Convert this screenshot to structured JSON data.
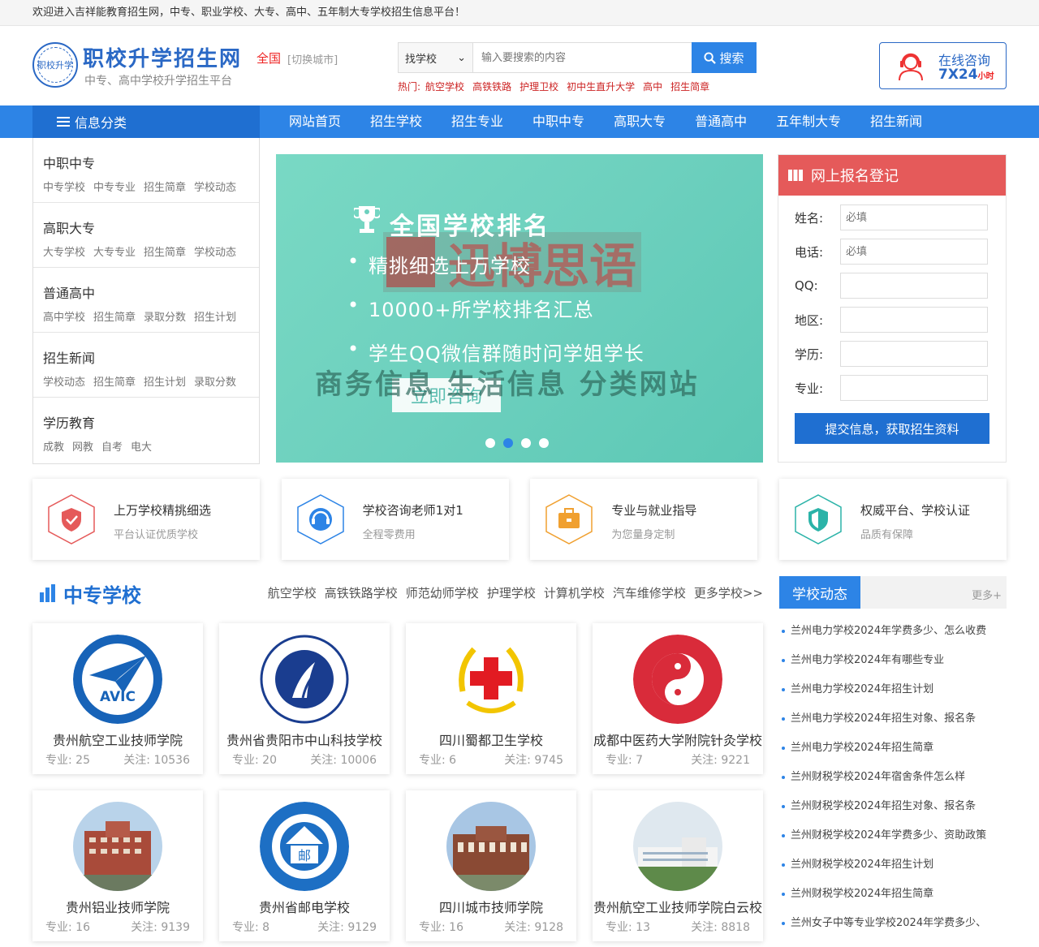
{
  "topbar": {
    "welcome": "欢迎进入吉祥能教育招生网，中专、职业学校、大专、高中、五年制大专学校招生信息平台！"
  },
  "header": {
    "logo_text": "职校升学",
    "title": "职校升学招生网",
    "subtitle": "中专、高中学校升学招生平台",
    "city": "全国",
    "city_switch": "[切换城市]",
    "search": {
      "select_value": "找学校",
      "placeholder": "输入要搜索的内容",
      "button": "搜索"
    },
    "hot_label": "热门:",
    "hot": [
      "航空学校",
      "高铁铁路",
      "护理卫校",
      "初中生直升大学",
      "高中",
      "招生简章"
    ],
    "consult": {
      "line1": "在线咨询",
      "line2": "7X24",
      "line2_small": "小时"
    }
  },
  "nav": {
    "category": "信息分类",
    "items": [
      "网站首页",
      "招生学校",
      "招生专业",
      "中职中专",
      "高职大专",
      "普通高中",
      "五年制大专",
      "招生新闻"
    ]
  },
  "sidebar": [
    {
      "title": "中职中专",
      "links": [
        "中专学校",
        "中专专业",
        "招生简章",
        "学校动态"
      ]
    },
    {
      "title": "高职大专",
      "links": [
        "大专学校",
        "大专专业",
        "招生简章",
        "学校动态"
      ]
    },
    {
      "title": "普通高中",
      "links": [
        "高中学校",
        "招生简章",
        "录取分数",
        "招生计划"
      ]
    },
    {
      "title": "招生新闻",
      "links": [
        "学校动态",
        "招生简章",
        "招生计划",
        "录取分数"
      ]
    },
    {
      "title": "学历教育",
      "links": [
        "成教",
        "网教",
        "自考",
        "电大"
      ]
    }
  ],
  "banner": {
    "title": "全国学校排名",
    "bullets": [
      "精挑细选上万学校",
      "10000+所学校排名汇总",
      "学生QQ微信群随时问学姐学长"
    ],
    "button": "立即咨询",
    "watermark": "迅博思语",
    "overlay": "商务信息 生活信息 分类网站",
    "active_slide": 2,
    "slide_count": 4
  },
  "register": {
    "title": "网上报名登记",
    "fields": [
      {
        "label": "姓名:",
        "placeholder": "必填"
      },
      {
        "label": "电话:",
        "placeholder": "必填"
      },
      {
        "label": "QQ:",
        "placeholder": ""
      },
      {
        "label": "地区:",
        "placeholder": ""
      },
      {
        "label": "学历:",
        "placeholder": ""
      },
      {
        "label": "专业:",
        "placeholder": ""
      }
    ],
    "submit": "提交信息，获取招生资料"
  },
  "features": [
    {
      "title": "上万学校精挑细选",
      "sub": "平台认证优质学校",
      "icon": "shield-check-icon",
      "color": "#e55a5a"
    },
    {
      "title": "学校咨询老师1对1",
      "sub": "全程零费用",
      "icon": "headset-icon",
      "color": "#2d84e6"
    },
    {
      "title": "专业与就业指导",
      "sub": "为您量身定制",
      "icon": "briefcase-icon",
      "color": "#f0a030"
    },
    {
      "title": "权威平台、学校认证",
      "sub": "品质有保障",
      "icon": "shield-half-icon",
      "color": "#2bb3a8"
    }
  ],
  "section": {
    "title": "中专学校",
    "tags": [
      "航空学校",
      "高铁铁路学校",
      "师范幼师学校",
      "护理学校",
      "计算机学校",
      "汽车维修学校",
      "更多学校>>"
    ],
    "major_label": "专业:",
    "follow_label": "关注:",
    "schools": [
      {
        "name": "贵州航空工业技师学院",
        "majors": "25",
        "follows": "10536",
        "logo": "avic"
      },
      {
        "name": "贵州省贵阳市中山科技学校",
        "majors": "20",
        "follows": "10006",
        "logo": "road"
      },
      {
        "name": "四川蜀都卫生学校",
        "majors": "6",
        "follows": "9745",
        "logo": "redcross"
      },
      {
        "name": "成都中医药大学附院针灸学校",
        "majors": "7",
        "follows": "9221",
        "logo": "taiji"
      },
      {
        "name": "贵州铝业技师学院",
        "majors": "16",
        "follows": "9139",
        "logo": "building"
      },
      {
        "name": "贵州省邮电学校",
        "majors": "8",
        "follows": "9129",
        "logo": "post"
      },
      {
        "name": "四川城市技师学院",
        "majors": "16",
        "follows": "9128",
        "logo": "building2"
      },
      {
        "name": "贵州航空工业技师学院白云校",
        "majors": "13",
        "follows": "8818",
        "logo": "campus"
      }
    ]
  },
  "news": {
    "title": "学校动态",
    "more": "更多+",
    "items": [
      "兰州电力学校2024年学费多少、怎么收费",
      "兰州电力学校2024年有哪些专业",
      "兰州电力学校2024年招生计划",
      "兰州电力学校2024年招生对象、报名条",
      "兰州电力学校2024年招生简章",
      "兰州财税学校2024年宿舍条件怎么样",
      "兰州财税学校2024年招生对象、报名条",
      "兰州财税学校2024年学费多少、资助政策",
      "兰州财税学校2024年招生计划",
      "兰州财税学校2024年招生简章",
      "兰州女子中等专业学校2024年学费多少、"
    ]
  }
}
